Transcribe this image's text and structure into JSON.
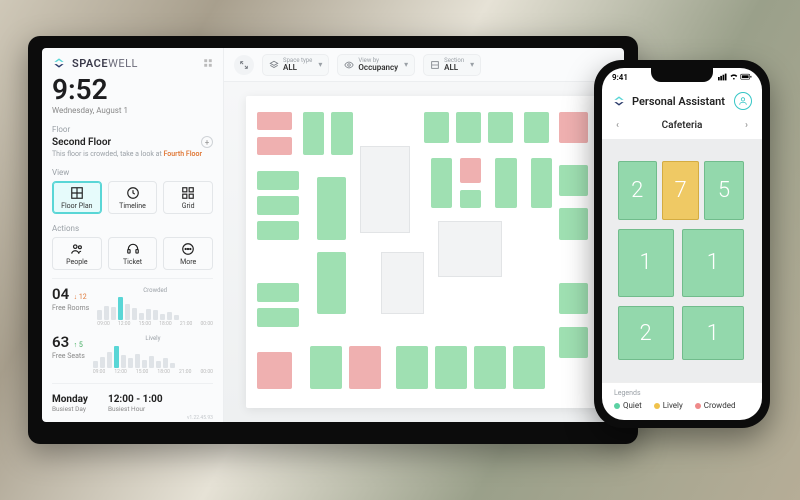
{
  "brand": {
    "name_a": "SPACE",
    "name_b": "WELL"
  },
  "clock": {
    "time": "9:52",
    "date": "Wednesday, August 1"
  },
  "floor": {
    "label": "Floor",
    "name": "Second Floor",
    "hint_pre": "This floor is crowded, take a look at ",
    "hint_link": "Fourth Floor"
  },
  "view": {
    "label": "View",
    "tabs": [
      {
        "label": "Floor Plan",
        "active": true
      },
      {
        "label": "Timeline",
        "active": false
      },
      {
        "label": "Grid",
        "active": false
      }
    ]
  },
  "actions": {
    "label": "Actions",
    "items": [
      {
        "label": "People"
      },
      {
        "label": "Ticket"
      },
      {
        "label": "More"
      }
    ]
  },
  "stats": {
    "rooms": {
      "value": "04",
      "delta": "↓ 12",
      "caption": "Free Rooms",
      "level": "Crowded"
    },
    "seats": {
      "value": "63",
      "delta": "↑ 5",
      "caption": "Free Seats",
      "level": "Lively"
    },
    "x_ticks": [
      "09:00",
      "12:00",
      "15:00",
      "18:00",
      "21:00",
      "00:00"
    ]
  },
  "busiest": {
    "day": {
      "value": "Monday",
      "caption": "Busiest Day"
    },
    "hour": {
      "value": "12:00 - 1:00",
      "caption": "Busiest Hour"
    }
  },
  "version": "v1.22.45.93",
  "topbar": {
    "space_type": {
      "label": "Space type",
      "value": "ALL"
    },
    "view_by": {
      "label": "View by",
      "value": "Occupancy"
    },
    "section": {
      "label": "Section",
      "value": "ALL"
    }
  },
  "phone": {
    "status_time": "9:41",
    "title": "Personal Assistant",
    "room": "Cafeteria",
    "legend_label": "Legends",
    "legend": {
      "quiet": "Quiet",
      "lively": "Lively",
      "crowded": "Crowded"
    },
    "tiles": [
      "2",
      "7",
      "5",
      "1",
      "1",
      "2",
      "1"
    ]
  }
}
